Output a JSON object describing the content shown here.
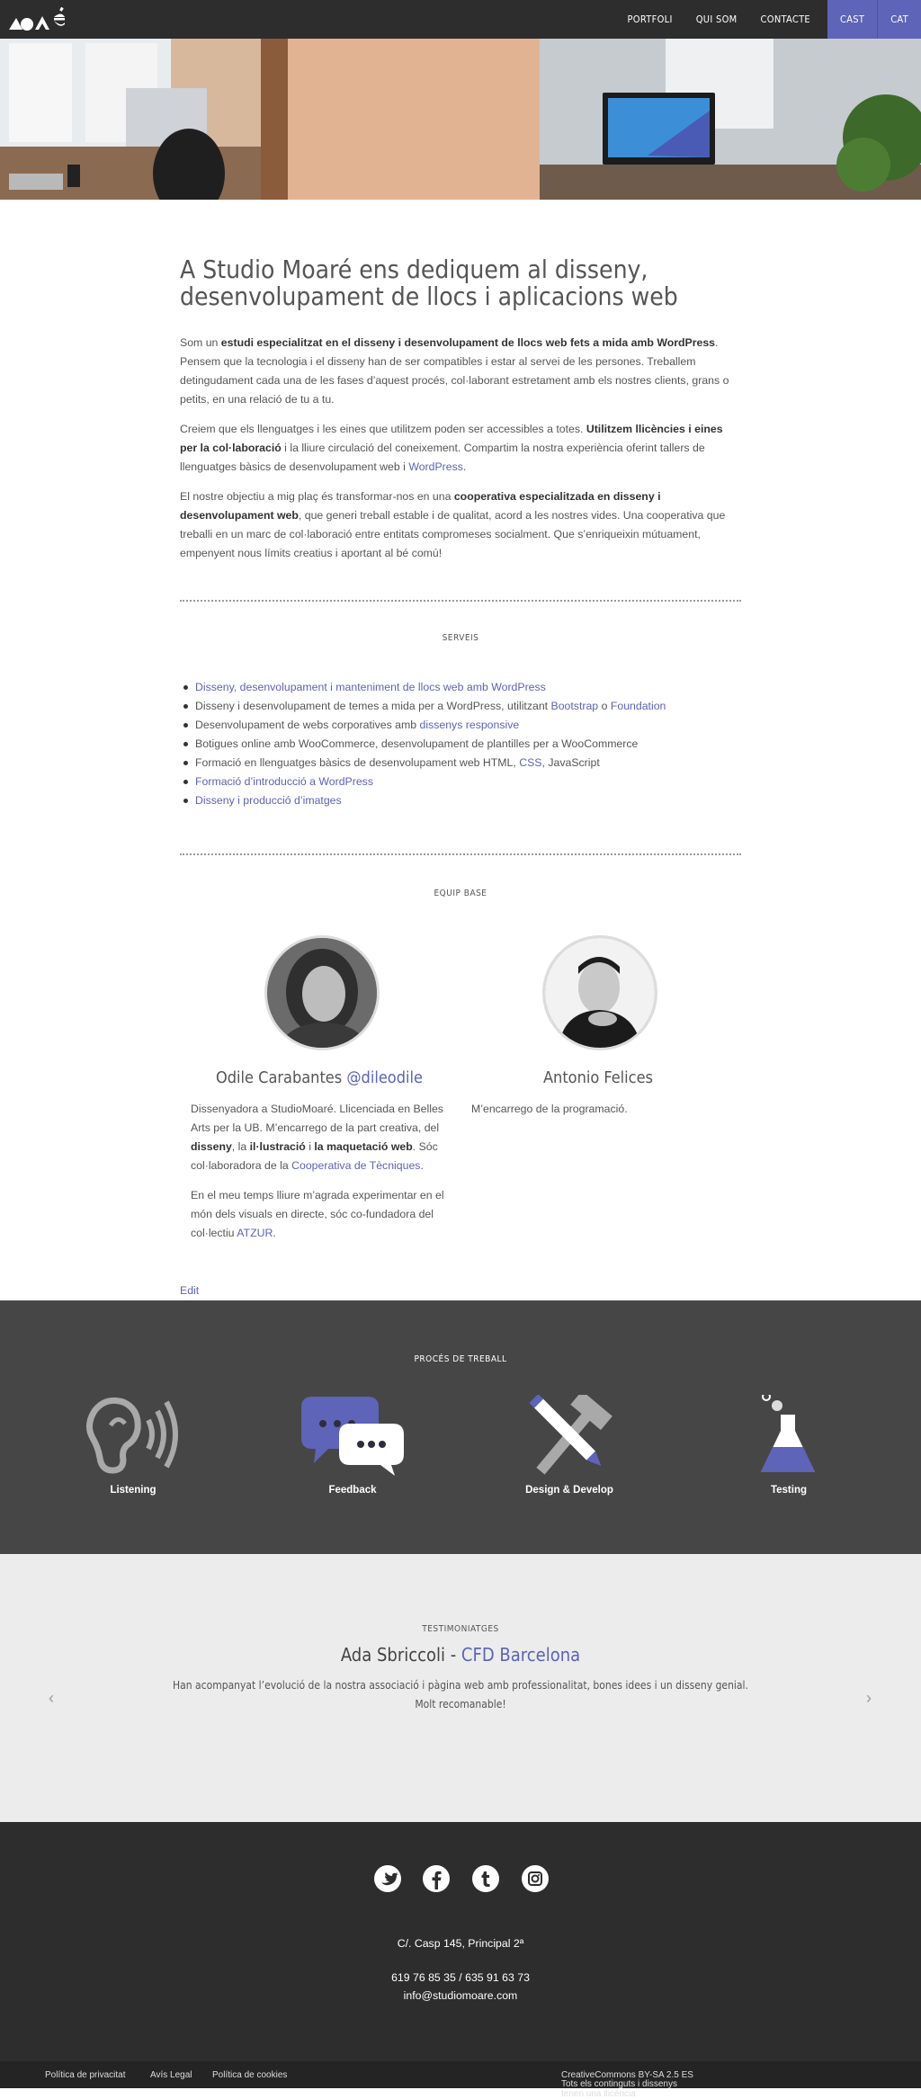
{
  "nav": {
    "items": [
      "PORTFOLI",
      "QUI SOM",
      "CONTACTE"
    ],
    "langs": [
      "CAST",
      "CAT"
    ]
  },
  "intro": {
    "title": "A Studio Moaré ens dediquem al disseny, desenvolupament de llocs i aplicacions web",
    "p1_a": "Som un ",
    "p1_b": "estudi especialitzat en el disseny i desenvolupament de llocs web fets a mida amb WordPress",
    "p1_c": ". Pensem que la tecnologia i el disseny han de ser compatibles i estar al servei de les persones. Treballem detingudament cada una de les fases d’aquest procés, col·laborant estretament amb els nostres clients, grans o petits, en una relació de tu a tu.",
    "p2_a": "Creiem que els llenguatges i les eines que utilitzem poden ser accessibles a totes. ",
    "p2_b": "Utilitzem llicències i eines per la col·laboració",
    "p2_c": " i la lliure circulació del coneixement. Compartim la nostra experiència oferint tallers de llenguatges bàsics de desenvolupament web i ",
    "p2_link": "WordPress",
    "p2_d": ".",
    "p3_a": "El nostre objectiu a mig plaç és transformar-nos en una ",
    "p3_b": "cooperativa especialitzada en disseny i desenvolupament web",
    "p3_c": ", que generi treball estable i de qualitat, acord a les nostres vides. Una cooperativa que treballi en un marc de col·laboració entre entitats compromeses socialment. Que s’enriqueixin mútuament, empenyent nous límits creatius i aportant al bé comú!"
  },
  "services": {
    "title": "SERVEIS",
    "s1": "Disseny, desenvolupament i manteniment de llocs web amb WordPress",
    "s2_a": "Disseny i desenvolupament de temes a mida per a WordPress, utilitzant ",
    "s2_l1": "Bootstrap",
    "s2_b": " o ",
    "s2_l2": "Foundation",
    "s3_a": "Desenvolupament de webs corporatives amb ",
    "s3_l": "dissenys responsive",
    "s4": "Botigues online amb WooCommerce, desenvolupament de plantilles per a WooCommerce",
    "s5_a": "Formació en llenguatges bàsics de desenvolupament web HTML, ",
    "s5_l": "CSS",
    "s5_b": ", JavaScript",
    "s6": "Formació d’introducció a WordPress",
    "s7": "Disseny i producció d’imatges"
  },
  "team": {
    "title": "EQUIP BASE",
    "m1_name": "Odile Carabantes ",
    "m1_handle": "@dileodile",
    "m1_p1_a": "Dissenyadora a StudioMoaré. Llicenciada en Belles Arts per la UB. M’encarrego de la part creativa, del ",
    "m1_p1_b1": "disseny",
    "m1_p1_c": ", la ",
    "m1_p1_b2": "il·lustració",
    "m1_p1_d": " i ",
    "m1_p1_b3": "la maquetació web",
    "m1_p1_e": ". Sóc col·laboradora de la ",
    "m1_p1_link": "Cooperativa de Tècniques",
    "m1_p1_f": ".",
    "m1_p2_a": "En el meu temps lliure m’agrada experimentar en el món dels visuals en directe, sóc co-fundadora del col·lectiu ",
    "m1_p2_link": "ATZUR",
    "m1_p2_b": ".",
    "m2_name": "Antonio Felices",
    "m2_bio": "M’encarrego de la programació.",
    "edit": "Edit"
  },
  "process": {
    "title": "PROCÉS DE TREBALL",
    "items": [
      "Listening",
      "Feedback",
      "Design & Develop",
      "Testing"
    ]
  },
  "testimonials": {
    "title": "TESTIMONIATGES",
    "name": "Ada Sbriccoli - ",
    "org": "CFD Barcelona",
    "text": "Han acompanyat l’evolució de la nostra associació i pàgina web amb professionalitat, bones idees i un disseny genial. Molt recomanable!",
    "prev": "‹",
    "next": "›"
  },
  "footer": {
    "address": "C/. Casp 145, Principal 2ª",
    "phone": "619 76 85 35 / 635 91 63 73",
    "email": "info@studiomoare.com",
    "links": [
      "Política de privacitat",
      "Avís Legal",
      "Política de cookies"
    ],
    "license_text": "Tots els continguts i dissenys tenen una llicència ",
    "license_link": "CreativeCommons BY-SA 2.5 ES"
  },
  "colors": {
    "accent": "#5e64b8",
    "dark": "#2d2d2d",
    "process_bg": "#464646",
    "testi_bg": "#ececec"
  }
}
